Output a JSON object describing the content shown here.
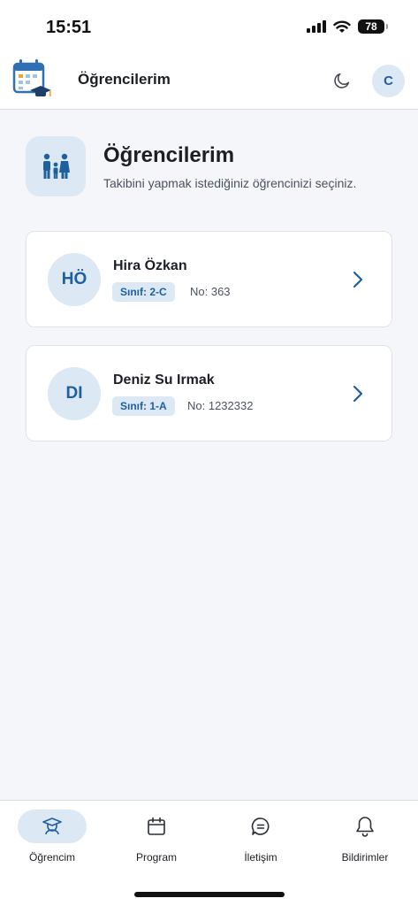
{
  "status_bar": {
    "time": "15:51",
    "battery": "78"
  },
  "header": {
    "title": "Öğrencilerim",
    "avatar_initial": "C"
  },
  "page": {
    "title": "Öğrencilerim",
    "subtitle": "Takibini yapmak istediğiniz öğrencinizi seçiniz."
  },
  "students": [
    {
      "initials": "HÖ",
      "name": "Hira Özkan",
      "class_label": "Sınıf: 2-C",
      "number_label": "No: 363"
    },
    {
      "initials": "DI",
      "name": "Deniz Su Irmak",
      "class_label": "Sınıf: 1-A",
      "number_label": "No: 1232332"
    }
  ],
  "tabs": [
    {
      "label": "Öğrencim",
      "icon": "graduate-icon",
      "active": true
    },
    {
      "label": "Program",
      "icon": "calendar-icon",
      "active": false
    },
    {
      "label": "İletişim",
      "icon": "chat-icon",
      "active": false
    },
    {
      "label": "Bildirimler",
      "icon": "bell-icon",
      "active": false
    }
  ],
  "colors": {
    "accent": "#1e5f9e",
    "accent_soft": "#dce8f4",
    "background": "#f4f6f9"
  }
}
